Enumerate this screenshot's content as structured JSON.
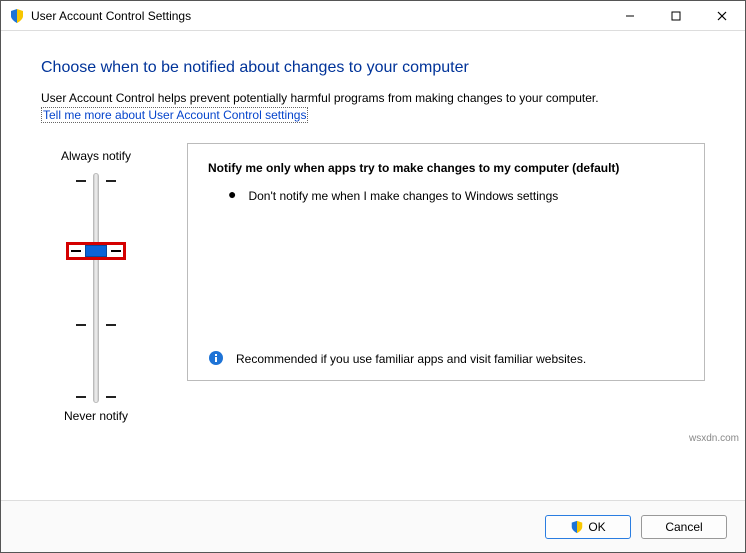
{
  "window": {
    "title": "User Account Control Settings"
  },
  "heading": "Choose when to be notified about changes to your computer",
  "description": "User Account Control helps prevent potentially harmful programs from making changes to your computer.",
  "link_text": "Tell me more about User Account Control settings",
  "slider": {
    "top_label": "Always notify",
    "bottom_label": "Never notify",
    "levels": 4,
    "selected_index": 1
  },
  "panel": {
    "title": "Notify me only when apps try to make changes to my computer (default)",
    "bullet": "Don't notify me when I make changes to Windows settings",
    "recommendation": "Recommended if you use familiar apps and visit familiar websites."
  },
  "buttons": {
    "ok": "OK",
    "cancel": "Cancel"
  },
  "watermark": "wsxdn.com"
}
